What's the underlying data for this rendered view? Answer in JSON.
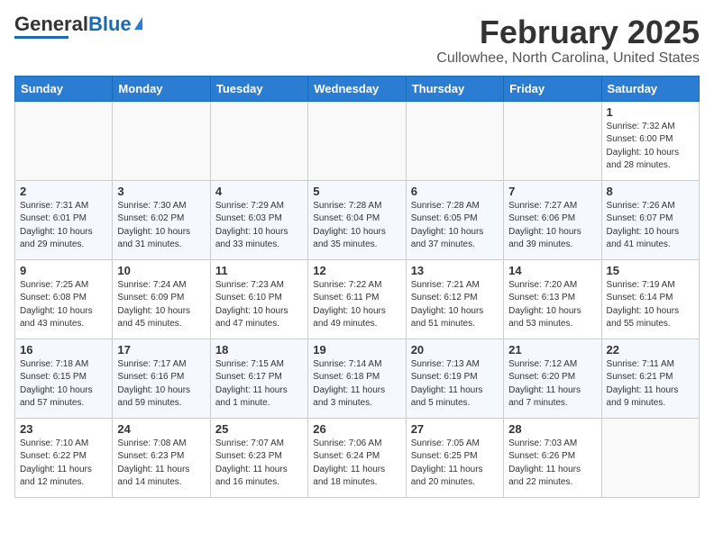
{
  "header": {
    "logo_line1": "General",
    "logo_line2": "Blue",
    "title": "February 2025",
    "subtitle": "Cullowhee, North Carolina, United States"
  },
  "weekdays": [
    "Sunday",
    "Monday",
    "Tuesday",
    "Wednesday",
    "Thursday",
    "Friday",
    "Saturday"
  ],
  "weeks": [
    [
      {
        "day": "",
        "info": ""
      },
      {
        "day": "",
        "info": ""
      },
      {
        "day": "",
        "info": ""
      },
      {
        "day": "",
        "info": ""
      },
      {
        "day": "",
        "info": ""
      },
      {
        "day": "",
        "info": ""
      },
      {
        "day": "1",
        "info": "Sunrise: 7:32 AM\nSunset: 6:00 PM\nDaylight: 10 hours and 28 minutes."
      }
    ],
    [
      {
        "day": "2",
        "info": "Sunrise: 7:31 AM\nSunset: 6:01 PM\nDaylight: 10 hours and 29 minutes."
      },
      {
        "day": "3",
        "info": "Sunrise: 7:30 AM\nSunset: 6:02 PM\nDaylight: 10 hours and 31 minutes."
      },
      {
        "day": "4",
        "info": "Sunrise: 7:29 AM\nSunset: 6:03 PM\nDaylight: 10 hours and 33 minutes."
      },
      {
        "day": "5",
        "info": "Sunrise: 7:28 AM\nSunset: 6:04 PM\nDaylight: 10 hours and 35 minutes."
      },
      {
        "day": "6",
        "info": "Sunrise: 7:28 AM\nSunset: 6:05 PM\nDaylight: 10 hours and 37 minutes."
      },
      {
        "day": "7",
        "info": "Sunrise: 7:27 AM\nSunset: 6:06 PM\nDaylight: 10 hours and 39 minutes."
      },
      {
        "day": "8",
        "info": "Sunrise: 7:26 AM\nSunset: 6:07 PM\nDaylight: 10 hours and 41 minutes."
      }
    ],
    [
      {
        "day": "9",
        "info": "Sunrise: 7:25 AM\nSunset: 6:08 PM\nDaylight: 10 hours and 43 minutes."
      },
      {
        "day": "10",
        "info": "Sunrise: 7:24 AM\nSunset: 6:09 PM\nDaylight: 10 hours and 45 minutes."
      },
      {
        "day": "11",
        "info": "Sunrise: 7:23 AM\nSunset: 6:10 PM\nDaylight: 10 hours and 47 minutes."
      },
      {
        "day": "12",
        "info": "Sunrise: 7:22 AM\nSunset: 6:11 PM\nDaylight: 10 hours and 49 minutes."
      },
      {
        "day": "13",
        "info": "Sunrise: 7:21 AM\nSunset: 6:12 PM\nDaylight: 10 hours and 51 minutes."
      },
      {
        "day": "14",
        "info": "Sunrise: 7:20 AM\nSunset: 6:13 PM\nDaylight: 10 hours and 53 minutes."
      },
      {
        "day": "15",
        "info": "Sunrise: 7:19 AM\nSunset: 6:14 PM\nDaylight: 10 hours and 55 minutes."
      }
    ],
    [
      {
        "day": "16",
        "info": "Sunrise: 7:18 AM\nSunset: 6:15 PM\nDaylight: 10 hours and 57 minutes."
      },
      {
        "day": "17",
        "info": "Sunrise: 7:17 AM\nSunset: 6:16 PM\nDaylight: 10 hours and 59 minutes."
      },
      {
        "day": "18",
        "info": "Sunrise: 7:15 AM\nSunset: 6:17 PM\nDaylight: 11 hours and 1 minute."
      },
      {
        "day": "19",
        "info": "Sunrise: 7:14 AM\nSunset: 6:18 PM\nDaylight: 11 hours and 3 minutes."
      },
      {
        "day": "20",
        "info": "Sunrise: 7:13 AM\nSunset: 6:19 PM\nDaylight: 11 hours and 5 minutes."
      },
      {
        "day": "21",
        "info": "Sunrise: 7:12 AM\nSunset: 6:20 PM\nDaylight: 11 hours and 7 minutes."
      },
      {
        "day": "22",
        "info": "Sunrise: 7:11 AM\nSunset: 6:21 PM\nDaylight: 11 hours and 9 minutes."
      }
    ],
    [
      {
        "day": "23",
        "info": "Sunrise: 7:10 AM\nSunset: 6:22 PM\nDaylight: 11 hours and 12 minutes."
      },
      {
        "day": "24",
        "info": "Sunrise: 7:08 AM\nSunset: 6:23 PM\nDaylight: 11 hours and 14 minutes."
      },
      {
        "day": "25",
        "info": "Sunrise: 7:07 AM\nSunset: 6:23 PM\nDaylight: 11 hours and 16 minutes."
      },
      {
        "day": "26",
        "info": "Sunrise: 7:06 AM\nSunset: 6:24 PM\nDaylight: 11 hours and 18 minutes."
      },
      {
        "day": "27",
        "info": "Sunrise: 7:05 AM\nSunset: 6:25 PM\nDaylight: 11 hours and 20 minutes."
      },
      {
        "day": "28",
        "info": "Sunrise: 7:03 AM\nSunset: 6:26 PM\nDaylight: 11 hours and 22 minutes."
      },
      {
        "day": "",
        "info": ""
      }
    ]
  ]
}
